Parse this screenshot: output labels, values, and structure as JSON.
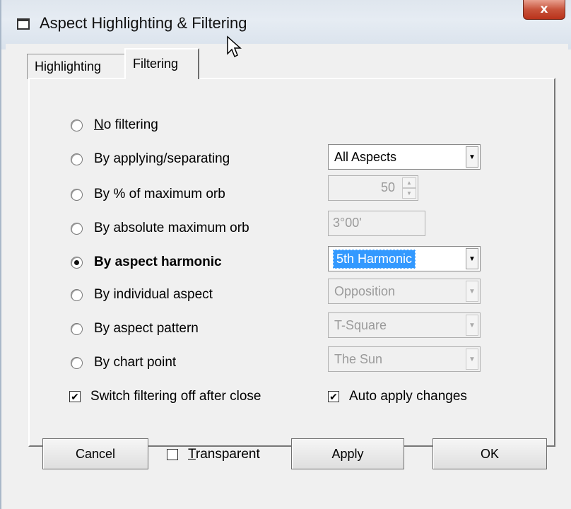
{
  "window": {
    "title": "Aspect Highlighting & Filtering",
    "close_label": "x"
  },
  "tabs": [
    {
      "label": "Highlighting",
      "active": false
    },
    {
      "label": "Filtering",
      "active": true
    }
  ],
  "options": {
    "no_filtering": {
      "label_u": "N",
      "label_rest": "o filtering",
      "selected": false
    },
    "by_applying": {
      "label": "By applying/separating",
      "selected": false,
      "combo_value": "All Aspects"
    },
    "by_pct_orb": {
      "label": "By % of maximum orb",
      "selected": false,
      "spin_value": "50"
    },
    "by_abs_orb": {
      "label": "By absolute maximum orb",
      "selected": false,
      "text_value": "3°00'"
    },
    "by_harmonic": {
      "label": "By aspect harmonic",
      "selected": true,
      "combo_value": "5th Harmonic"
    },
    "by_individual": {
      "label": "By individual aspect",
      "selected": false,
      "combo_value": "Opposition"
    },
    "by_pattern": {
      "label": "By aspect pattern",
      "selected": false,
      "combo_value": "T-Square"
    },
    "by_chart_point": {
      "label": "By chart point",
      "selected": false,
      "combo_value": "The Sun"
    }
  },
  "checkboxes": {
    "switch_off": {
      "label": "Switch filtering off after close",
      "checked": true
    },
    "auto_apply": {
      "label": "Auto apply changes",
      "checked": true
    },
    "transparent": {
      "label_u": "T",
      "label_rest": "ransparent",
      "checked": false
    }
  },
  "buttons": {
    "cancel": "Cancel",
    "apply": "Apply",
    "ok": "OK"
  },
  "glyphs": {
    "check": "✔",
    "dropdown": "▼",
    "spin_up": "▲",
    "spin_down": "▼"
  }
}
